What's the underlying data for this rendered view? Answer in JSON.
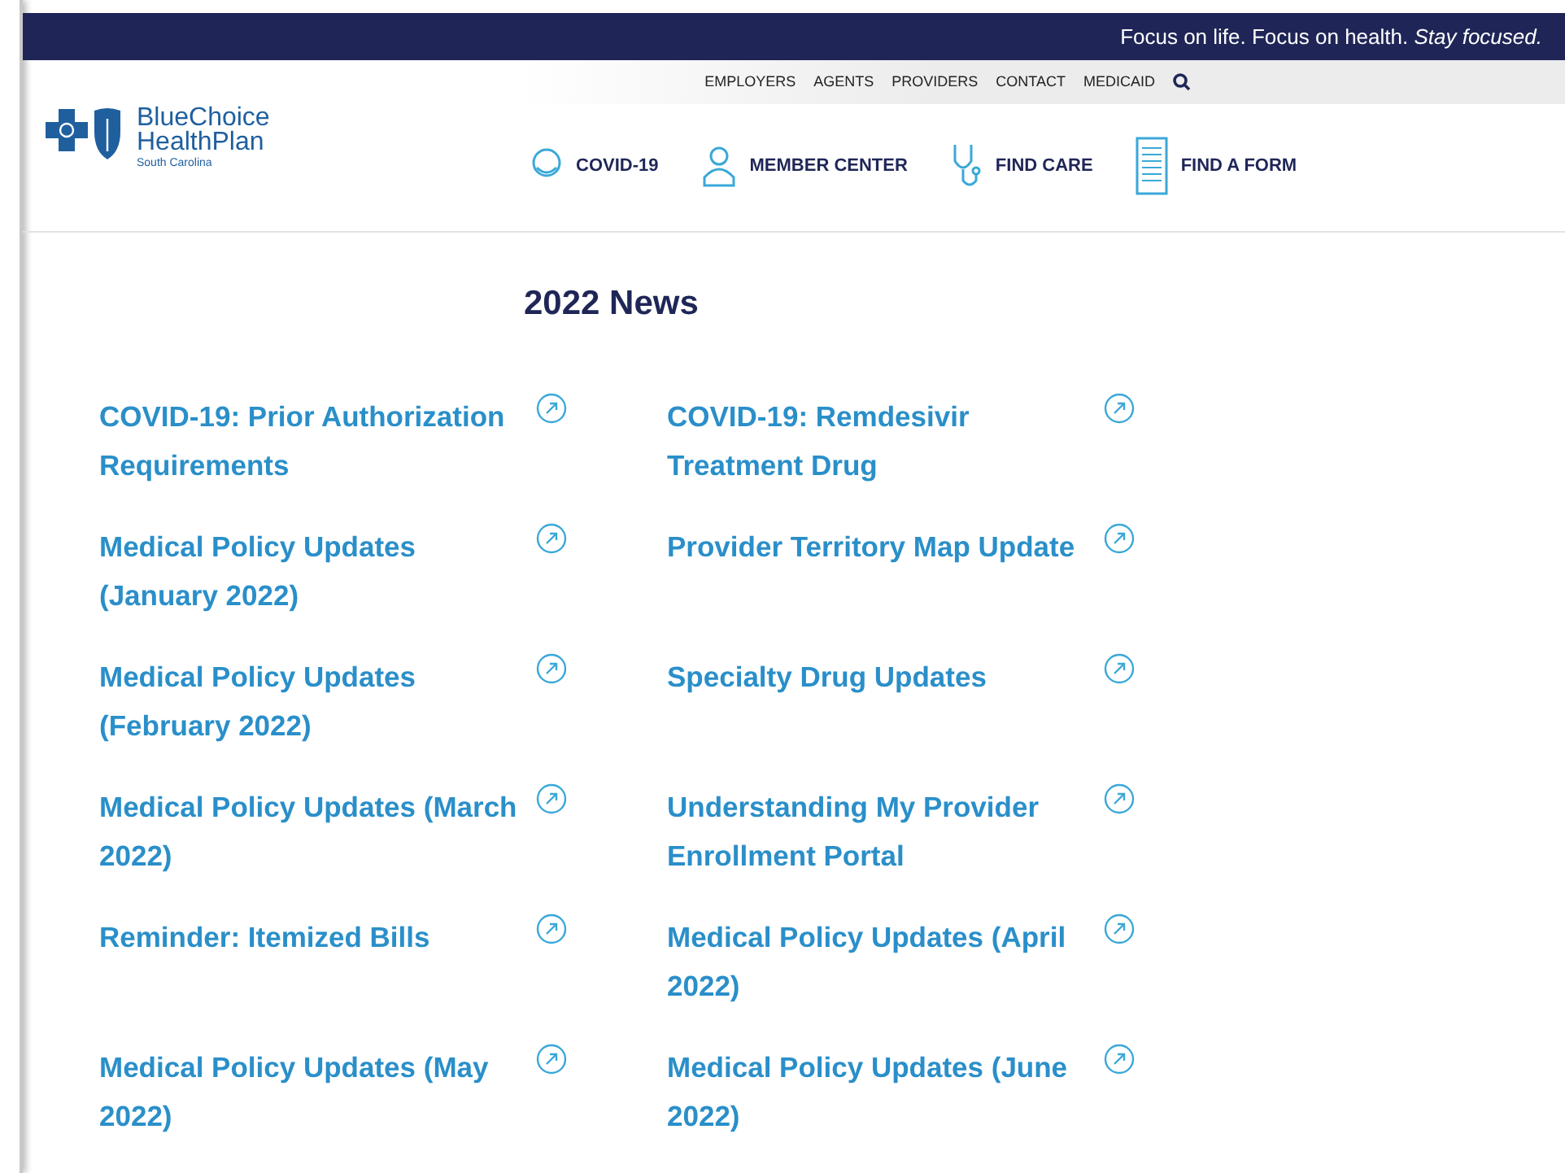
{
  "top_bar": {
    "tagline": "Focus on life. Focus on health. *Stay focused.*"
  },
  "utility_nav": [
    "EMPLOYERS",
    "AGENTS",
    "PROVIDERS",
    "CONTACT",
    "MEDICAID"
  ],
  "logo": {
    "name_line_1": "BlueChoice",
    "name_line_2": "HealthPlan",
    "region": "South Carolina"
  },
  "main_nav": [
    {
      "kind": "covid",
      "label": "COVID-19"
    },
    {
      "kind": "member",
      "label": "MEMBER CENTER"
    },
    {
      "kind": "care",
      "label": "FIND CARE"
    },
    {
      "kind": "form",
      "label": "FIND A FORM"
    }
  ],
  "news": {
    "title": "2022 News",
    "items": [
      {
        "title": "COVID-19: Prior Authorization Requirements"
      },
      {
        "title": "COVID-19: Remdesivir Treatment Drug"
      },
      {
        "title": "Medical Policy Updates (January 2022)"
      },
      {
        "title": "Provider Territory Map Update"
      },
      {
        "title": "Medical Policy Updates (February 2022)"
      },
      {
        "title": "Specialty Drug Updates"
      },
      {
        "title": "Medical Policy Updates (March 2022)"
      },
      {
        "title": "Understanding My Provider Enrollment Portal"
      },
      {
        "title": "Reminder: Itemized Bills"
      },
      {
        "title": "Medical Policy Updates (April 2022)"
      },
      {
        "title": "Medical Policy Updates (May 2022)"
      },
      {
        "title": "Medical Policy Updates (June 2022)"
      }
    ]
  }
}
